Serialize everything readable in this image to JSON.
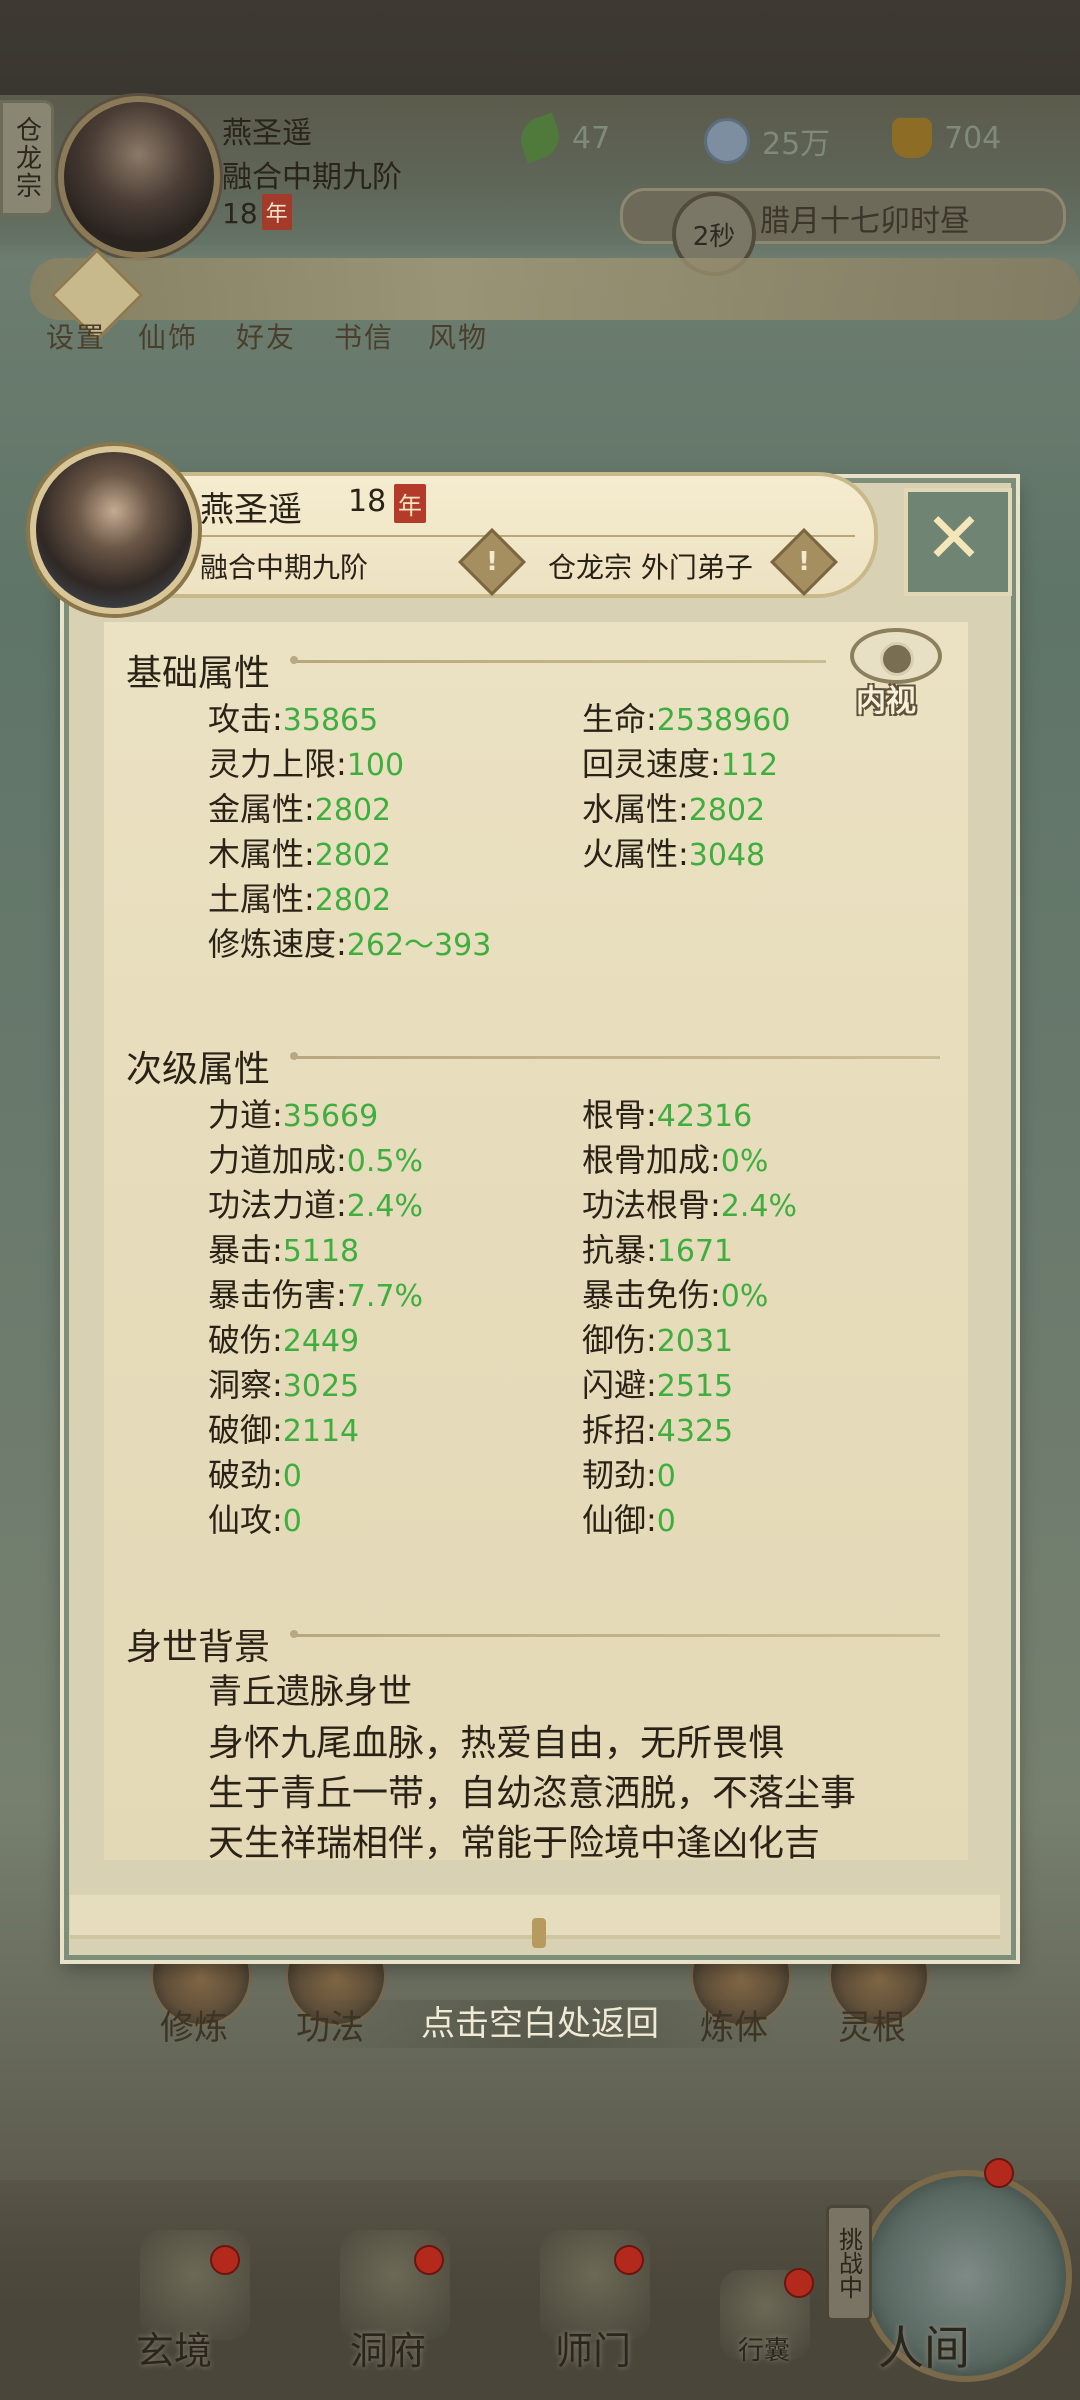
{
  "top": {
    "sect": "仓龙宗",
    "name": "燕圣遥",
    "realm": "融合中期九阶",
    "age": "18",
    "age_unit": "年",
    "resources": [
      {
        "icon": "leaf-icon",
        "value": "47"
      },
      {
        "icon": "coin-icon",
        "value": "25万"
      },
      {
        "icon": "gold-icon",
        "value": "704"
      }
    ],
    "timer": "2秒",
    "game_time": "腊月十七卯时昼",
    "quick_menu": [
      "设置",
      "仙饰",
      "好友",
      "书信",
      "风物"
    ]
  },
  "panel": {
    "name": "燕圣遥",
    "age": "18",
    "age_unit": "年",
    "realm": "融合中期九阶",
    "sect": "仓龙宗 外门弟子",
    "inner_view": "内视",
    "basic": {
      "title": "基础属性",
      "left": [
        {
          "label": "攻击",
          "value": "35865"
        },
        {
          "label": "灵力上限",
          "value": "100"
        },
        {
          "label": "金属性",
          "value": "2802"
        },
        {
          "label": "木属性",
          "value": "2802"
        },
        {
          "label": "土属性",
          "value": "2802"
        },
        {
          "label": "修炼速度",
          "value": "262～393"
        }
      ],
      "right": [
        {
          "label": "生命",
          "value": "2538960"
        },
        {
          "label": "回灵速度",
          "value": "112"
        },
        {
          "label": "水属性",
          "value": "2802"
        },
        {
          "label": "火属性",
          "value": "3048"
        }
      ]
    },
    "secondary": {
      "title": "次级属性",
      "left": [
        {
          "label": "力道",
          "value": "35669"
        },
        {
          "label": "力道加成",
          "value": "0.5%"
        },
        {
          "label": "功法力道",
          "value": "2.4%"
        },
        {
          "label": "暴击",
          "value": "5118"
        },
        {
          "label": "暴击伤害",
          "value": "7.7%"
        },
        {
          "label": "破伤",
          "value": "2449"
        },
        {
          "label": "洞察",
          "value": "3025"
        },
        {
          "label": "破御",
          "value": "2114"
        },
        {
          "label": "破劲",
          "value": "0"
        },
        {
          "label": "仙攻",
          "value": "0"
        }
      ],
      "right": [
        {
          "label": "根骨",
          "value": "42316"
        },
        {
          "label": "根骨加成",
          "value": "0%"
        },
        {
          "label": "功法根骨",
          "value": "2.4%"
        },
        {
          "label": "抗暴",
          "value": "1671"
        },
        {
          "label": "暴击免伤",
          "value": "0%"
        },
        {
          "label": "御伤",
          "value": "2031"
        },
        {
          "label": "闪避",
          "value": "2515"
        },
        {
          "label": "拆招",
          "value": "4325"
        },
        {
          "label": "韧劲",
          "value": "0"
        },
        {
          "label": "仙御",
          "value": "0"
        }
      ]
    },
    "background": {
      "title": "身世背景",
      "lines": [
        "青丘遗脉身世",
        "身怀九尾血脉，热爱自由，无所畏惧",
        "生于青丘一带，自幼恣意洒脱，不落尘事",
        "天生祥瑞相伴，常能于险境中逢凶化吉"
      ]
    }
  },
  "hint": "点击空白处返回",
  "menu": [
    "修炼",
    "功法",
    "",
    "",
    "",
    "炼体",
    "灵根"
  ],
  "bottom_nav": {
    "items": [
      "玄境",
      "洞府",
      "师门",
      "行囊",
      "人间"
    ],
    "challenge": "挑战中"
  }
}
